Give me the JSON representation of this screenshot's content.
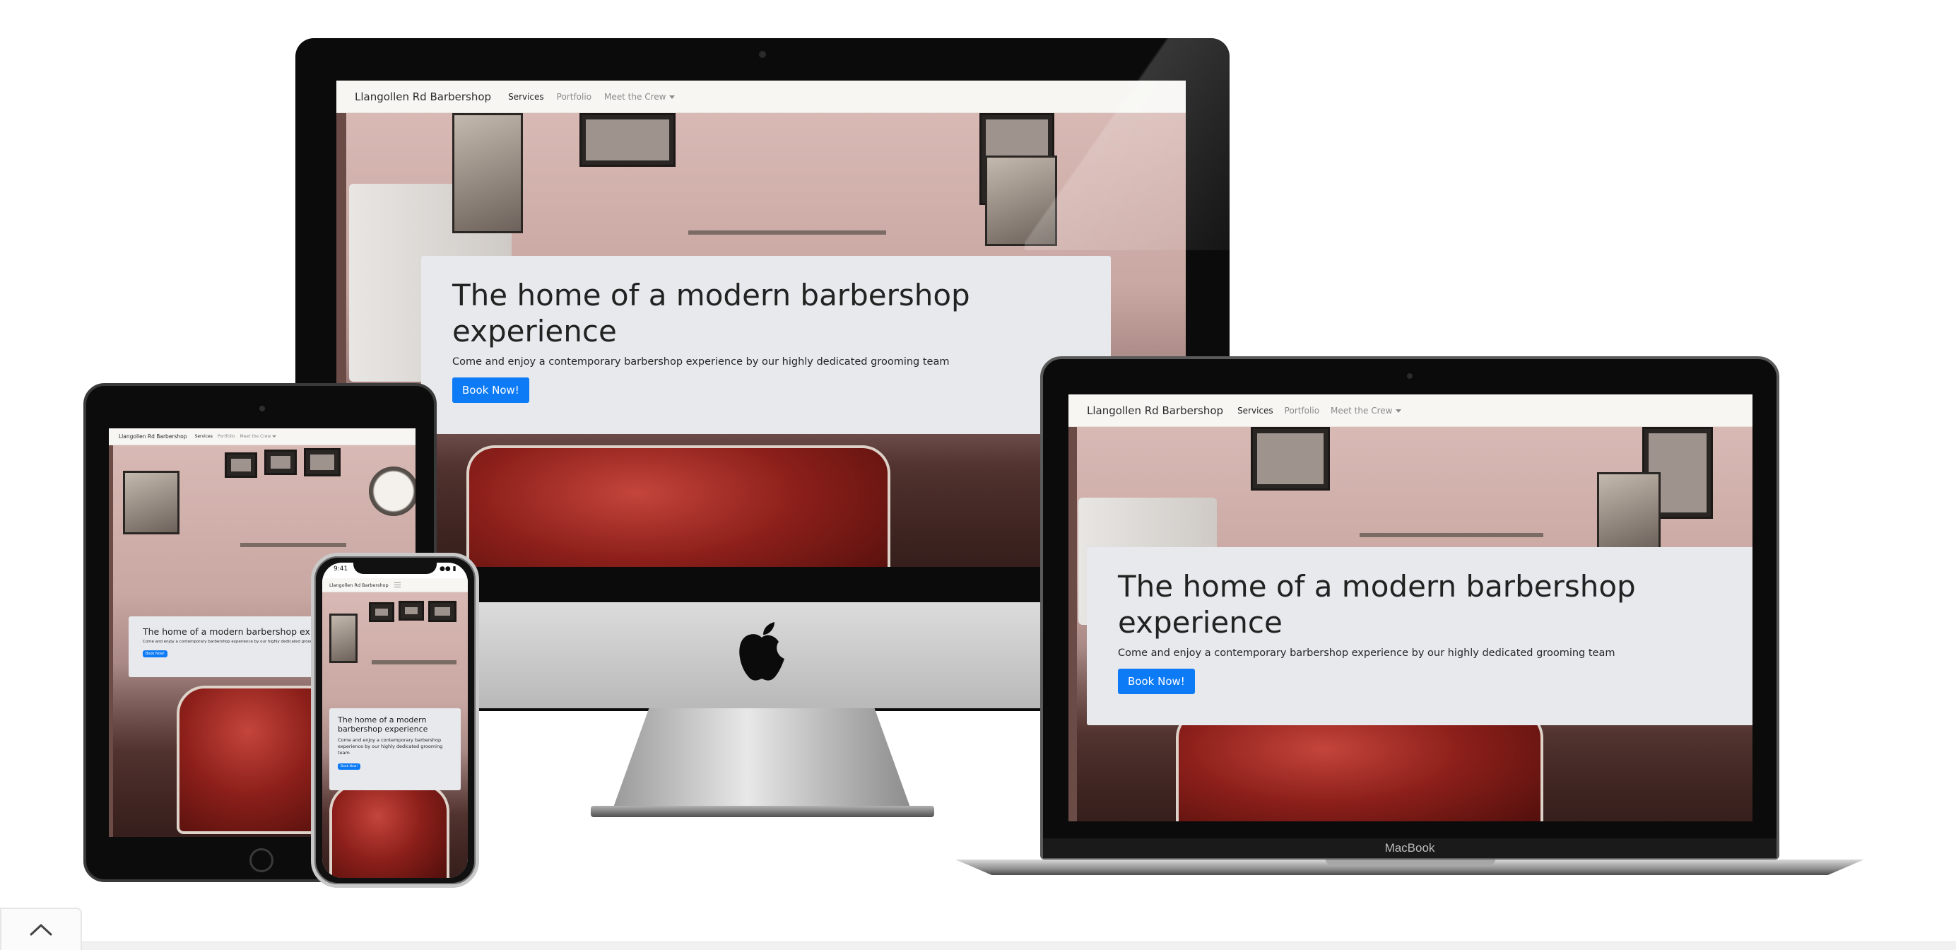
{
  "site": {
    "brand": "Llangollen Rd Barbershop",
    "nav": [
      {
        "label": "Services",
        "active": true
      },
      {
        "label": "Portfolio",
        "active": false
      },
      {
        "label": "Meet the Crew",
        "dropdown": true
      }
    ],
    "hero": {
      "title": "The home of a modern barbershop experience",
      "subtitle": "Come and enjoy a contemporary barbershop experience by our highly dedicated grooming team",
      "button_label": "Book Now!"
    }
  },
  "devices": {
    "laptop_label": "MacBook",
    "phone_time": "9:41"
  },
  "icons": {
    "apple_logo": "apple-logo-icon",
    "scroll_top": "chevron-up-icon",
    "hamburger": "menu-icon"
  },
  "colors": {
    "button": "#0d7bf6",
    "hero_panel": "#e7e9ec",
    "navbar": "#f7f6f3"
  }
}
